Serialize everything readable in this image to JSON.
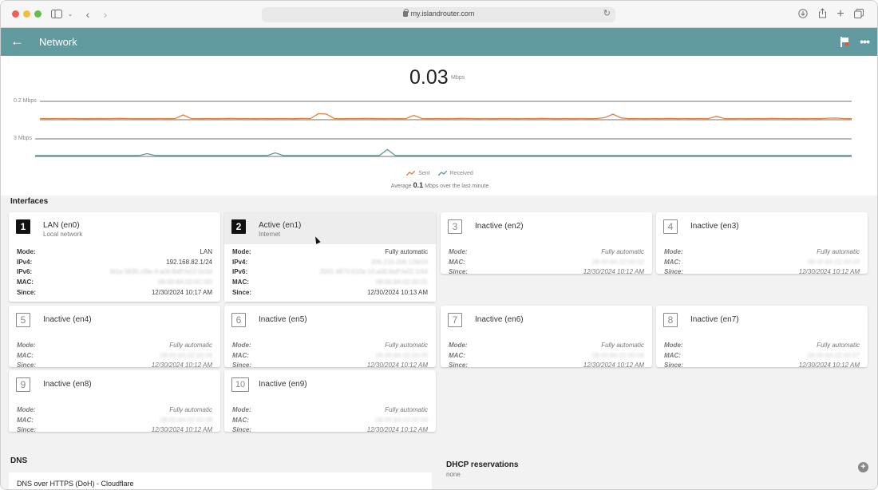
{
  "browser": {
    "url": "my.islandrouter.com",
    "lock_icon": "lock-icon",
    "reload_icon": "reload-icon"
  },
  "appbar": {
    "title": "Network",
    "back_icon": "arrow-left-icon",
    "flag_icon": "flag-icon",
    "more_icon": "more-horizontal-icon"
  },
  "throughput": {
    "value": "0.03",
    "unit": "Mbps",
    "sent_scale_label": "0.2 Mbps",
    "received_scale_label": "3 Mbps",
    "legend_sent": "Sent",
    "legend_received": "Received",
    "average_prefix": "Average",
    "average_value": "0.1",
    "average_suffix": "Mbps over the last minute",
    "colors": {
      "sent": "#e8803a",
      "received": "#5e9aa0"
    }
  },
  "chart_data": {
    "type": "line",
    "series": [
      {
        "name": "Sent",
        "ylim": [
          0,
          0.2
        ],
        "values": [
          0.005,
          0.004,
          0.005,
          0.004,
          0.005,
          0.004,
          0.003,
          0.005,
          0.004,
          0.005,
          0.006,
          0.005,
          0.004,
          0.004,
          0.004,
          0.005,
          0.004,
          0.005,
          0.045,
          0.005,
          0.004,
          0.005,
          0.004,
          0.005,
          0.006,
          0.004,
          0.005,
          0.004,
          0.005,
          0.004,
          0.005,
          0.005,
          0.004,
          0.006,
          0.005,
          0.06,
          0.055,
          0.005,
          0.004,
          0.005,
          0.005,
          0.006,
          0.005,
          0.004,
          0.005,
          0.004,
          0.005,
          0.04,
          0.005,
          0.004,
          0.005,
          0.004,
          0.005,
          0.006,
          0.005,
          0.004,
          0.005,
          0.004,
          0.005,
          0.005,
          0.004,
          0.005,
          0.004,
          0.006,
          0.005,
          0.004,
          0.005,
          0.004,
          0.005,
          0.004,
          0.005,
          0.015,
          0.055,
          0.012,
          0.004,
          0.005,
          0.004,
          0.005,
          0.004,
          0.006,
          0.004,
          0.005,
          0.004,
          0.005,
          0.004,
          0.03,
          0.005,
          0.004,
          0.005,
          0.004,
          0.005,
          0.004,
          0.006,
          0.005,
          0.004,
          0.005,
          0.004,
          0.005,
          0.004,
          0.008,
          0.01,
          0.005,
          0.004
        ]
      },
      {
        "name": "Received",
        "ylim": [
          0,
          3
        ],
        "values": [
          0.02,
          0.02,
          0.02,
          0.02,
          0.02,
          0.02,
          0.02,
          0.02,
          0.02,
          0.02,
          0.02,
          0.02,
          0.02,
          0.02,
          0.35,
          0.02,
          0.02,
          0.02,
          0.02,
          0.02,
          0.02,
          0.02,
          0.02,
          0.02,
          0.02,
          0.02,
          0.02,
          0.02,
          0.02,
          0.02,
          0.5,
          0.02,
          0.02,
          0.02,
          0.02,
          0.02,
          0.02,
          0.02,
          0.02,
          0.02,
          0.02,
          0.02,
          0.02,
          0.02,
          1.1,
          0.02,
          0.02,
          0.02,
          0.02,
          0.02,
          0.02,
          0.02,
          0.02,
          0.02,
          0.02,
          0.02,
          0.02,
          0.02,
          0.02,
          0.02,
          0.02,
          0.02,
          0.02,
          0.02,
          0.02,
          0.02,
          0.02,
          0.02,
          0.02,
          0.02,
          0.02,
          0.02,
          0.02,
          0.02,
          0.02,
          0.02,
          0.02,
          0.02,
          0.02,
          0.02,
          0.02,
          0.02,
          0.02,
          0.02,
          0.02,
          0.02,
          0.02,
          0.02,
          0.02,
          0.02,
          0.02,
          0.02,
          0.02,
          0.02,
          0.02,
          0.02,
          0.02,
          0.02,
          0.02,
          0.02,
          0.02,
          0.02,
          0.02
        ]
      }
    ],
    "grid": false,
    "legend": "bottom-center"
  },
  "interfaces_title": "Interfaces",
  "labels": {
    "mode": "Mode:",
    "ipv4": "IPv4:",
    "ipv6": "IPv6:",
    "mac": "MAC:",
    "since": "Since:"
  },
  "interfaces": [
    {
      "number": "1",
      "title": "LAN (en0)",
      "subtitle": "Local network",
      "state": "lan",
      "mode": "LAN",
      "ipv4": "192.168.82.1/24",
      "ipv6": "fd1e:5835:cf9e:4:a00:8aff:fe02:0c0d",
      "mac": "08:00:8A:02:0C:0D",
      "since": "12/30/2024 10:17 AM"
    },
    {
      "number": "2",
      "title": "Active (en1)",
      "subtitle": "Internet",
      "state": "active",
      "mode": "Fully automatic",
      "ipv4": "206.210.206.128/24",
      "ipv6": "2001:4870:610e:16:a00:8aff:fe02:1/64",
      "mac": "08:00:8A:02:00:01",
      "since": "12/30/2024 10:13 AM"
    },
    {
      "number": "3",
      "title": "Inactive (en2)",
      "state": "inactive",
      "mode": "Fully automatic",
      "mac": "08:00:8A:02:00:02",
      "since": "12/30/2024 10:12 AM"
    },
    {
      "number": "4",
      "title": "Inactive (en3)",
      "state": "inactive",
      "mode": "Fully automatic",
      "mac": "08:00:8A:02:00:03",
      "since": "12/30/2024 10:12 AM"
    },
    {
      "number": "5",
      "title": "Inactive (en4)",
      "state": "inactive",
      "mode": "Fully automatic",
      "mac": "08:00:8A:02:00:04",
      "since": "12/30/2024 10:12 AM"
    },
    {
      "number": "6",
      "title": "Inactive (en5)",
      "state": "inactive",
      "mode": "Fully automatic",
      "mac": "08:00:8A:02:00:05",
      "since": "12/30/2024 10:12 AM"
    },
    {
      "number": "7",
      "title": "Inactive (en6)",
      "state": "inactive",
      "mode": "Fully automatic",
      "mac": "08:00:8A:02:00:06",
      "since": "12/30/2024 10:12 AM"
    },
    {
      "number": "8",
      "title": "Inactive (en7)",
      "state": "inactive",
      "mode": "Fully automatic",
      "mac": "08:00:8A:02:00:07",
      "since": "12/30/2024 10:12 AM"
    },
    {
      "number": "9",
      "title": "Inactive (en8)",
      "state": "inactive",
      "mode": "Fully automatic",
      "mac": "08:00:8A:02:00:08",
      "since": "12/30/2024 10:12 AM"
    },
    {
      "number": "10",
      "title": "Inactive (en9)",
      "state": "inactive",
      "mode": "Fully automatic",
      "mac": "08:00:8A:02:00:09",
      "since": "12/30/2024 10:12 AM"
    }
  ],
  "dns": {
    "title": "DNS",
    "item": "DNS over HTTPS (DoH) - Cloudflare"
  },
  "dhcp": {
    "title": "DHCP reservations",
    "value": "none",
    "add_icon": "add-circle-icon"
  }
}
